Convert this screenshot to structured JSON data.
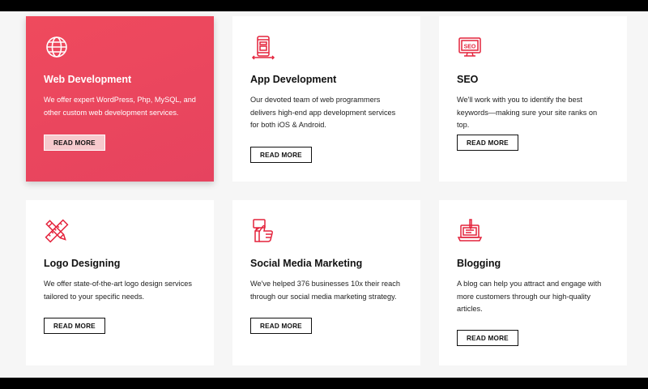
{
  "colors": {
    "accent": "#e8455e",
    "icon": "#e4233c",
    "text": "#111111"
  },
  "services": [
    {
      "icon": "globe-icon",
      "title": "Web Development",
      "description": "We offer expert WordPress, Php, MySQL, and other custom web development services.",
      "button": "READ MORE",
      "active": true
    },
    {
      "icon": "mobile-app-icon",
      "title": "App Development",
      "description": "Our devoted team of web programmers delivers high-end app development services for both iOS & Android.",
      "button": "READ MORE",
      "active": false
    },
    {
      "icon": "seo-monitor-icon",
      "title": "SEO",
      "description": "We'll work with you to identify the best keywords—making sure your site ranks on top.",
      "button": "READ MORE",
      "active": false
    },
    {
      "icon": "ruler-pencil-icon",
      "title": "Logo Designing",
      "description": "We offer state-of-the-art logo design services tailored to your specific needs.",
      "button": "READ MORE",
      "active": false
    },
    {
      "icon": "thumbs-up-icon",
      "title": "Social Media Marketing",
      "description": "We've helped 376  businesses 10x their reach through our social media marketing strategy.",
      "button": "READ MORE",
      "active": false
    },
    {
      "icon": "blog-laptop-icon",
      "title": "Blogging",
      "description": "A blog can help you attract and engage with more customers through our high-quality articles.",
      "button": "READ MORE",
      "active": false
    }
  ]
}
